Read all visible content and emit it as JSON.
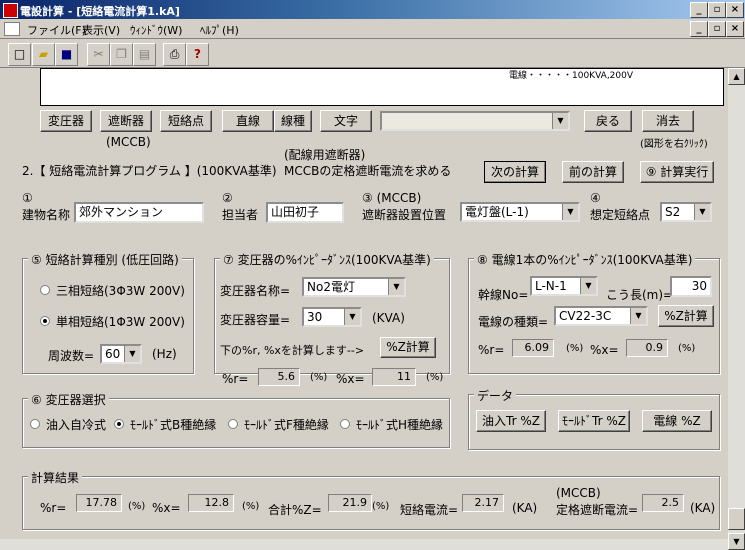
{
  "window": {
    "title": "電設計算 - [短絡電流計算1.kA]"
  },
  "menu": [
    "ファイル(F)",
    "表示(V)",
    "ｳｨﾝﾄﾞｳ(W)",
    "ﾍﾙﾌﾟ(H)"
  ],
  "toolbar_icons": [
    "new-file-icon",
    "open-folder-icon",
    "save-icon",
    "cut-icon",
    "copy-icon",
    "paste-icon",
    "print-icon",
    "help-icon"
  ],
  "strip": {
    "text": "電線・・・・・100KVA,200V"
  },
  "draw_buttons": {
    "transformer": "変圧器",
    "breaker": "遮断器",
    "breaker_note": "(MCCB)",
    "short_point": "短絡点",
    "straight": "直線",
    "line_type": "線種",
    "text": "文字",
    "back": "戻る",
    "erase": "消去",
    "erase_note": "(図形を右ｸﾘｯｸ)"
  },
  "program": {
    "title": "2.【 短絡電流計算プログラム 】(100KVA基準)",
    "desc_line1": "(配線用遮断器)",
    "desc_line2": "MCCBの定格遮断電流を求める",
    "next_calc": "次の計算",
    "prev_calc": "前の計算",
    "run_calc": "⑨ 計算実行"
  },
  "fields": {
    "n1": "①",
    "building_label": "建物名称",
    "building_value": "郊外マンション",
    "n2": "②",
    "person_label": "担当者",
    "person_value": "山田初子",
    "n3": "③ (MCCB)",
    "breaker_pos_label": "遮断器設置位置",
    "breaker_pos_value": "電灯盤(L-1)",
    "n4": "④",
    "short_point_label": "想定短絡点",
    "short_point_value": "S2"
  },
  "group5": {
    "title": "⑤ 短絡計算種別 (低圧回路)",
    "opt_three": "三相短絡(3Φ3W 200V)",
    "opt_single": "単相短絡(1Φ3W 200V)",
    "selected": "single",
    "freq_label": "周波数=",
    "freq_value": "60",
    "freq_unit": "(Hz)"
  },
  "group7": {
    "title": "⑦ 変圧器の%ｲﾝﾋﾟｰﾀﾞﾝｽ(100KVA基準)",
    "name_label": "変圧器名称=",
    "name_value": "No2電灯",
    "cap_label": "変圧器容量=",
    "cap_value": "30",
    "cap_unit": "(KVA)",
    "calc_note": "下の%r, %xを計算します-->",
    "calc_btn": "%Z計算",
    "r_label": "%r=",
    "r_value": "5.6",
    "x_label": "%x=",
    "x_value": "11",
    "pct": "(%)"
  },
  "group8": {
    "title": "⑧ 電線1本の%ｲﾝﾋﾟｰﾀﾞﾝｽ(100KVA基準)",
    "trunk_label": "幹線No=",
    "trunk_value": "L-N-1",
    "len_label": "こう長(m)=",
    "len_value": "30",
    "type_label": "電線の種類=",
    "type_value": "CV22-3C",
    "calc_btn": "%Z計算",
    "r_label": "%r=",
    "r_value": "6.09",
    "x_label": "%x=",
    "x_value": "0.9",
    "pct": "(%)"
  },
  "group6": {
    "title": "⑥ 変圧器選択",
    "options": [
      "油入自冷式",
      "ﾓｰﾙﾄﾞ式B種絶縁",
      "ﾓｰﾙﾄﾞ式F種絶縁",
      "ﾓｰﾙﾄﾞ式H種絶縁"
    ],
    "selected_index": 1
  },
  "data_group": {
    "title": "データ",
    "oil_btn": "油入Tr %Z",
    "mold_btn": "ﾓｰﾙﾄﾞTr %Z",
    "wire_btn": "電線 %Z"
  },
  "results": {
    "title": "計算結果",
    "r_label": "%r=",
    "r_value": "17.78",
    "x_label": "%x=",
    "x_value": "12.8",
    "z_label": "合計%Z=",
    "z_value": "21.9",
    "pct": "(%)",
    "sc_label": "短絡電流=",
    "sc_value": "2.17",
    "ka": "(KA)",
    "mccb_label1": "(MCCB)",
    "mccb_label2": "定格遮断電流=",
    "mccb_value": "2.5"
  }
}
